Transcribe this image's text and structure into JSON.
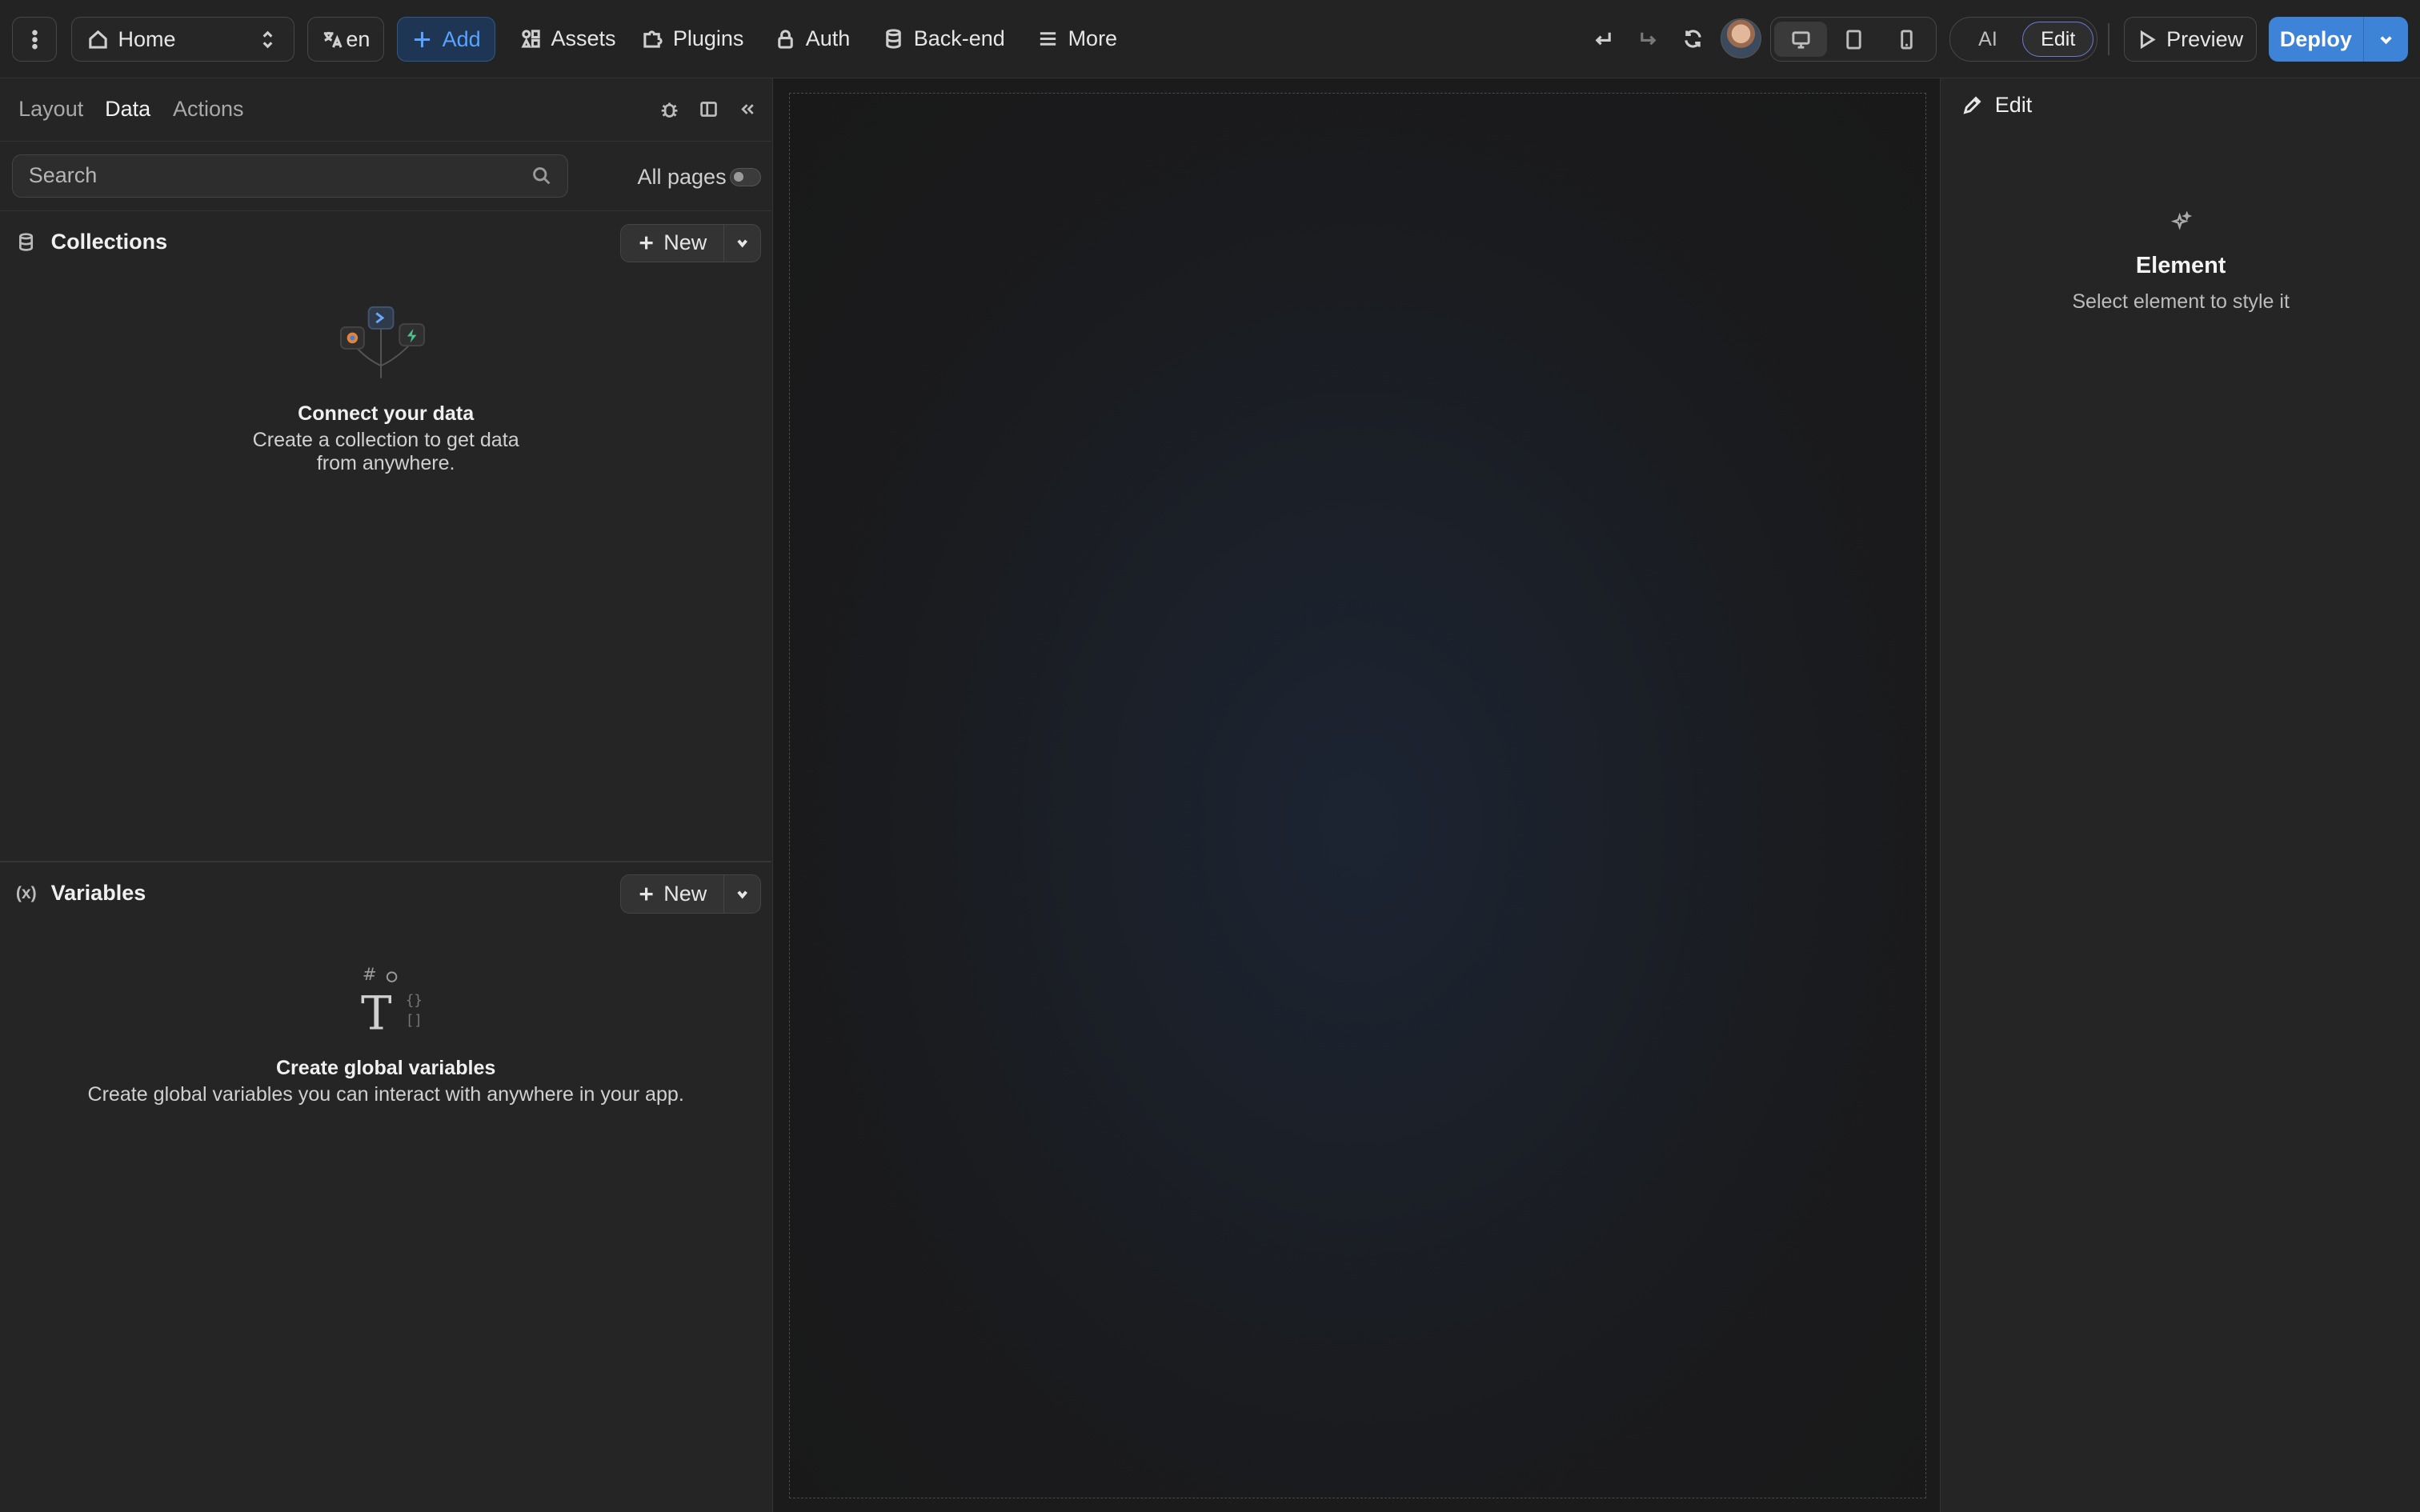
{
  "topbar": {
    "page_select": "Home",
    "language": "en",
    "add_label": "Add",
    "nav": {
      "assets": "Assets",
      "plugins": "Plugins",
      "auth": "Auth",
      "backend": "Back-end",
      "more": "More"
    },
    "mode": {
      "ai": "AI",
      "edit": "Edit",
      "active": "Edit"
    },
    "device_active": "desktop",
    "preview_label": "Preview",
    "deploy_label": "Deploy"
  },
  "left_panel": {
    "tabs": [
      "Layout",
      "Data",
      "Actions"
    ],
    "active_tab": "Data",
    "search": {
      "placeholder": "Search",
      "value": ""
    },
    "all_pages_label": "All pages",
    "all_pages_on": false,
    "collections": {
      "title": "Collections",
      "new_label": "New",
      "empty_title": "Connect your data",
      "empty_desc_line1": "Create a collection to get data",
      "empty_desc_line2": "from anywhere."
    },
    "variables": {
      "icon_text": "(x)",
      "title": "Variables",
      "new_label": "New",
      "empty_title": "Create global variables",
      "empty_desc": "Create global variables you can interact with anywhere in your app."
    }
  },
  "right_panel": {
    "header": "Edit",
    "empty_title": "Element",
    "empty_desc": "Select element to style it"
  },
  "colors": {
    "accent": "#3d84d8",
    "add_text": "#5aa2ff",
    "background": "#1e1e1e",
    "panel": "#252525"
  }
}
